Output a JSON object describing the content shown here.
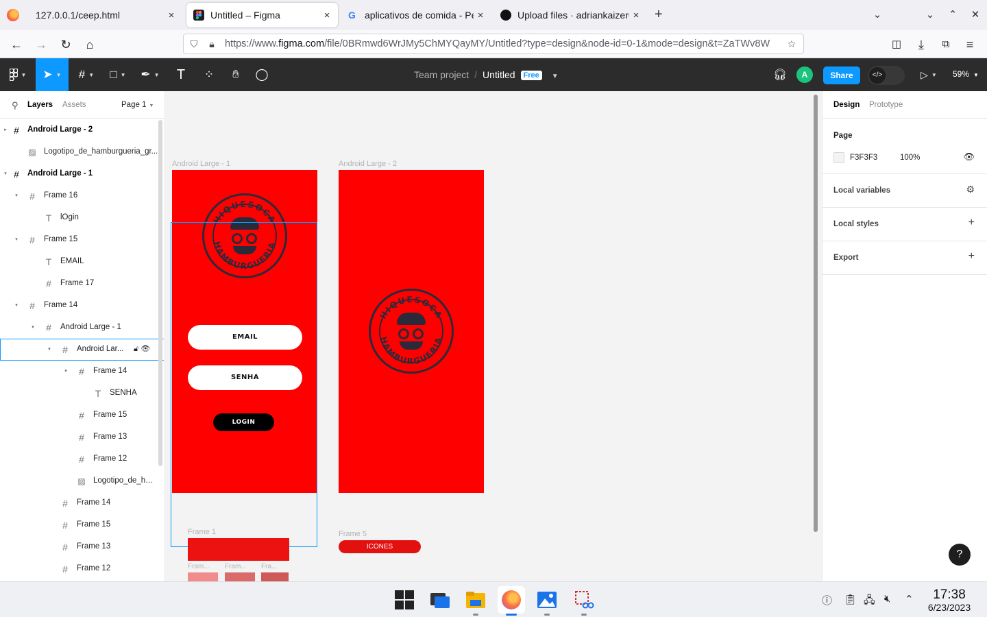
{
  "browser": {
    "tabs": [
      {
        "label": "127.0.0.1/ceep.html",
        "close": "×"
      },
      {
        "label": "Untitled – Figma",
        "close": "×"
      },
      {
        "label": "aplicativos de comida - Pes",
        "close": "×"
      },
      {
        "label": "Upload files · adriankaizer6",
        "close": "×"
      }
    ],
    "new_tab": "+",
    "url_prefix": "https://www.",
    "url_domain": "figma.com",
    "url_rest": "/file/0BRmwd6WrJMy5ChMYQayMY/Untitled?type=design&node-id=0-1&mode=design&t=ZaTWv8W",
    "icons": [
      "back-icon",
      "forward-icon",
      "reload-icon",
      "home-icon",
      "shield-icon",
      "lock-icon",
      "bookmark-star-icon",
      "pocket-icon",
      "download-icon",
      "extensions-icon",
      "menu-icon"
    ]
  },
  "figma": {
    "team": "Team project",
    "separator": "/",
    "file_name": "Untitled",
    "plan_badge": "Free",
    "share": "Share",
    "avatar_initial": "A",
    "zoom": "59%",
    "dev_mode_glyph": "</>",
    "colors": {
      "accent": "#0d99ff",
      "toolbar": "#2c2c2c",
      "artboard_red": "#ff0000",
      "canvas_bg": "#f3f3f3"
    }
  },
  "layers_panel": {
    "tab_layers": "Layers",
    "tab_assets": "Assets",
    "page": "Page 1",
    "layers": [
      {
        "name": "Android Large - 2",
        "icon": "frame-icon",
        "twisty": "▸"
      },
      {
        "name": "Logotipo_de_hamburgueria_gr...",
        "icon": "image-icon",
        "twisty": ""
      },
      {
        "name": "Android Large - 1",
        "icon": "frame-icon",
        "twisty": "▾"
      },
      {
        "name": "Frame 16",
        "icon": "frame-icon",
        "twisty": "▾"
      },
      {
        "name": "lOgin",
        "icon": "text-icon",
        "twisty": ""
      },
      {
        "name": "Frame 15",
        "icon": "frame-icon",
        "twisty": "▾"
      },
      {
        "name": "EMAIL",
        "icon": "text-icon",
        "twisty": ""
      },
      {
        "name": "Frame 17",
        "icon": "frame-icon",
        "twisty": ""
      },
      {
        "name": "Frame 14",
        "icon": "frame-icon",
        "twisty": "▾"
      },
      {
        "name": "Android Large - 1",
        "icon": "frame-icon",
        "twisty": "▾"
      },
      {
        "name": "Android Lar...",
        "icon": "frame-icon",
        "twisty": "▾"
      },
      {
        "name": "Frame 14",
        "icon": "frame-icon",
        "twisty": "▾"
      },
      {
        "name": "SENHA",
        "icon": "text-icon",
        "twisty": ""
      },
      {
        "name": "Frame 15",
        "icon": "frame-icon",
        "twisty": ""
      },
      {
        "name": "Frame 13",
        "icon": "frame-icon",
        "twisty": ""
      },
      {
        "name": "Frame 12",
        "icon": "frame-icon",
        "twisty": ""
      },
      {
        "name": "Logotipo_de_ha...",
        "icon": "image-icon",
        "twisty": ""
      },
      {
        "name": "Frame 14",
        "icon": "frame-icon",
        "twisty": ""
      },
      {
        "name": "Frame 15",
        "icon": "frame-icon",
        "twisty": ""
      },
      {
        "name": "Frame 13",
        "icon": "frame-icon",
        "twisty": ""
      },
      {
        "name": "Frame 12",
        "icon": "frame-icon",
        "twisty": ""
      }
    ]
  },
  "canvas": {
    "frame1_label": "Android Large - 1",
    "frame2_label": "Android Large - 2",
    "logo_top": "HIQUESOCA",
    "logo_bottom": "HAMBURGUERIA",
    "email_field": "EMAIL",
    "password_field": "SENHA",
    "login_button": "LOGIN",
    "frame_1_label": "Frame 1",
    "frame_5_label": "Frame 5",
    "icons_button": "ICONES",
    "swatch_labels": [
      "Fram...",
      "Fram...",
      "Fra..."
    ],
    "swatch_colors": [
      "#f28b8b",
      "#d96b6b",
      "#cf5858"
    ]
  },
  "design_panel": {
    "tab_design": "Design",
    "tab_prototype": "Prototype",
    "page_heading": "Page",
    "page_color": "F3F3F3",
    "page_opacity": "100%",
    "local_variables": "Local variables",
    "local_styles": "Local styles",
    "export": "Export",
    "help": "?"
  },
  "taskbar": {
    "time": "17:38",
    "date": "6/23/2023"
  }
}
